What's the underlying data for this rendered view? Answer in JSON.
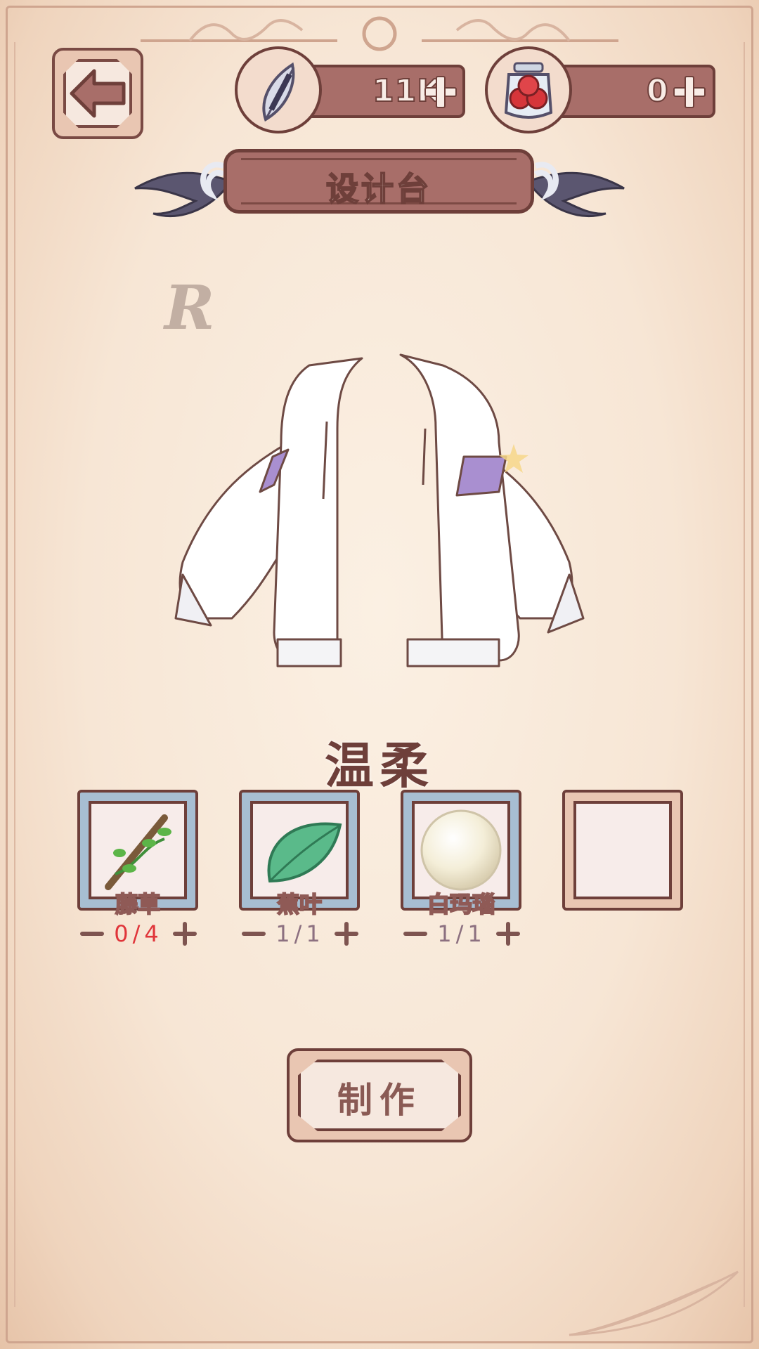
{
  "header": {
    "currencies": [
      {
        "icon": "quill-feather-icon",
        "value": "11K"
      },
      {
        "icon": "berry-jar-icon",
        "value": "0"
      }
    ]
  },
  "title": "设计台",
  "item": {
    "rarity": "R",
    "image": "white-hooded-jacket",
    "style": "温柔"
  },
  "materials": [
    {
      "name": "藤草",
      "icon": "vine-branch-icon",
      "count": "0/4",
      "sufficient": false
    },
    {
      "name": "蕉叶",
      "icon": "banana-leaf-icon",
      "count": "1/1",
      "sufficient": true
    },
    {
      "name": "白玛瑙",
      "icon": "white-pearl-icon",
      "count": "1/1",
      "sufficient": true
    },
    {
      "name": "",
      "icon": "",
      "count": "",
      "sufficient": true
    }
  ],
  "craft_button": "制作",
  "colors": {
    "frame": "#6e3f3a",
    "banner": "#a86e69",
    "slot_blue": "#a7bed2",
    "shortage_red": "#e0353a"
  }
}
